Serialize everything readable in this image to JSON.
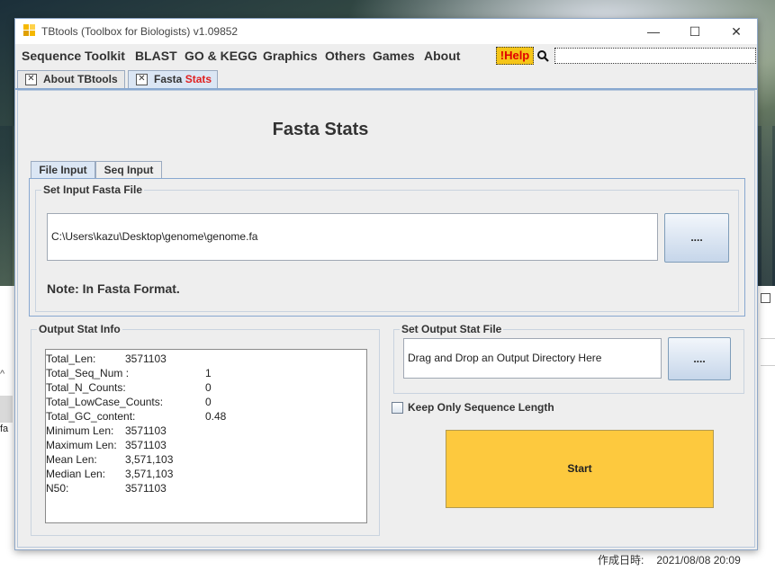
{
  "window": {
    "title": "TBtools (Toolbox for Biologists) v1.09852",
    "minimize_glyph": "—",
    "maximize_glyph": "☐",
    "close_glyph": "✕"
  },
  "menu": [
    "Sequence Toolkit",
    "BLAST",
    "GO & KEGG",
    "Graphics",
    "Others",
    "Games",
    "About"
  ],
  "help_label": "!Help",
  "search_value": "",
  "doc_tabs": {
    "about": "About TBtools",
    "fasta_prefix": "Fasta",
    "fasta_suffix": "Stats",
    "close_glyph": "✕"
  },
  "page_title": "Fasta Stats",
  "inner_tabs": [
    "File Input",
    "Seq Input"
  ],
  "input_group": {
    "legend": "Set Input Fasta File",
    "path": "C:\\Users\\kazu\\Desktop\\genome\\genome.fa",
    "browse_label": "....",
    "note": "Note: In Fasta Format."
  },
  "output_stat_info": {
    "legend": "Output Stat Info",
    "rows": [
      {
        "key": "Total_Len:",
        "value": "3571103",
        "indent": "short"
      },
      {
        "key": "Total_Seq_Num :",
        "value": "1",
        "indent": "long"
      },
      {
        "key": "Total_N_Counts:",
        "value": "0",
        "indent": "long"
      },
      {
        "key": "Total_LowCase_Counts:",
        "value": "0",
        "indent": "long"
      },
      {
        "key": "Total_GC_content:",
        "value": "0.48",
        "indent": "long"
      },
      {
        "key": "Minimum Len:",
        "value": "3571103",
        "indent": "short"
      },
      {
        "key": "Maximum Len:",
        "value": "3571103",
        "indent": "short"
      },
      {
        "key": "Mean Len:",
        "value": "3,571,103",
        "indent": "short"
      },
      {
        "key": "Median Len:",
        "value": "3,571,103",
        "indent": "short"
      },
      {
        "key": "N50:",
        "value": "3571103",
        "indent": "short"
      }
    ]
  },
  "output_file": {
    "legend": "Set Output Stat File",
    "placeholder": "Drag and Drop an Output Directory Here",
    "browse_label": "...."
  },
  "keep_length_label": "Keep Only Sequence Length",
  "start_label": "Start",
  "desktop": {
    "explorer_fa": "fa",
    "explorer_caret": "^",
    "created_label": "作成日時:",
    "created_value": "2021/08/08 20:09"
  }
}
